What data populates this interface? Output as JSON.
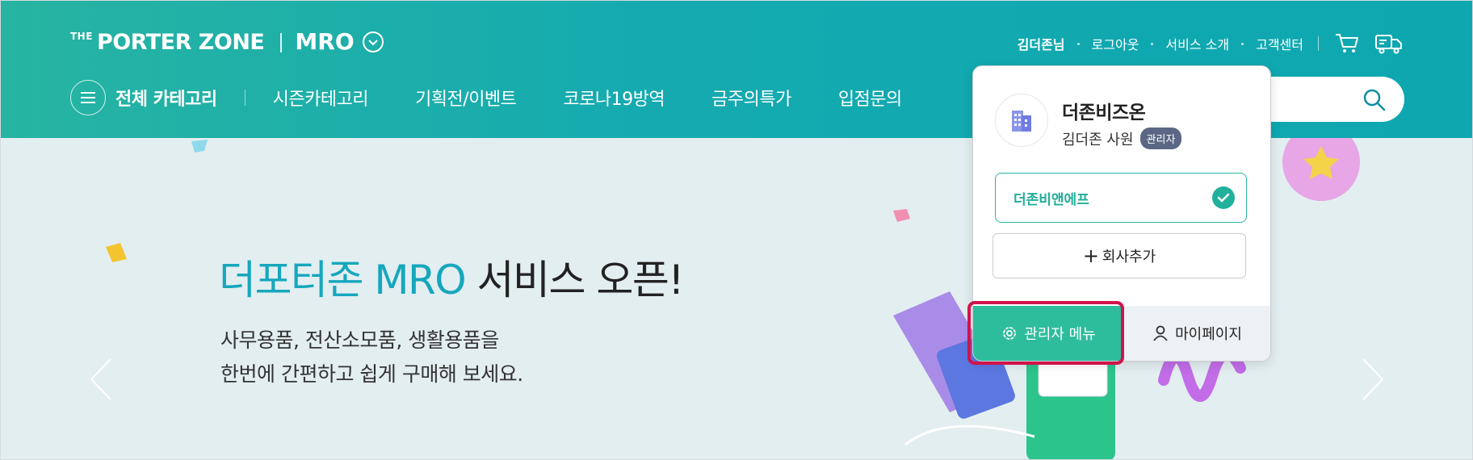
{
  "header": {
    "logo": {
      "prefix": "THE",
      "name": "PORTER ZONE",
      "service": "MRO"
    },
    "util": {
      "user": "김더존님",
      "links": [
        "로그아웃",
        "서비스 소개",
        "고객센터"
      ],
      "icons": [
        "cart-icon",
        "delivery-truck-icon"
      ]
    },
    "nav": {
      "all_categories": "전체 카테고리",
      "items": [
        "시즌카테고리",
        "기획전/이벤트",
        "코로나19방역",
        "금주의특가",
        "입점문의"
      ]
    },
    "search": {
      "icon": "search-icon"
    }
  },
  "banner": {
    "title_accent": "더포터존 MRO",
    "title_rest": " 서비스 오픈!",
    "subtitle_line1": "사무용품, 전산소모품, 생활용품을",
    "subtitle_line2": "한번에 간편하고 쉽게 구매해 보세요."
  },
  "popup": {
    "company_name": "더존비즈온",
    "user_name": "김더존 사원",
    "role_badge": "관리자",
    "selected_company": "더존비앤에프",
    "add_company_label": "회사추가",
    "admin_menu_label": "관리자 메뉴",
    "mypage_label": "마이페이지"
  },
  "colors": {
    "header_gradient_start": "#27b4a2",
    "header_gradient_end": "#0ea7b0",
    "accent": "#16a7bd",
    "admin_button": "#2ebd9c",
    "highlight": "#d1134b",
    "banner_bg": "#e3eef1"
  }
}
